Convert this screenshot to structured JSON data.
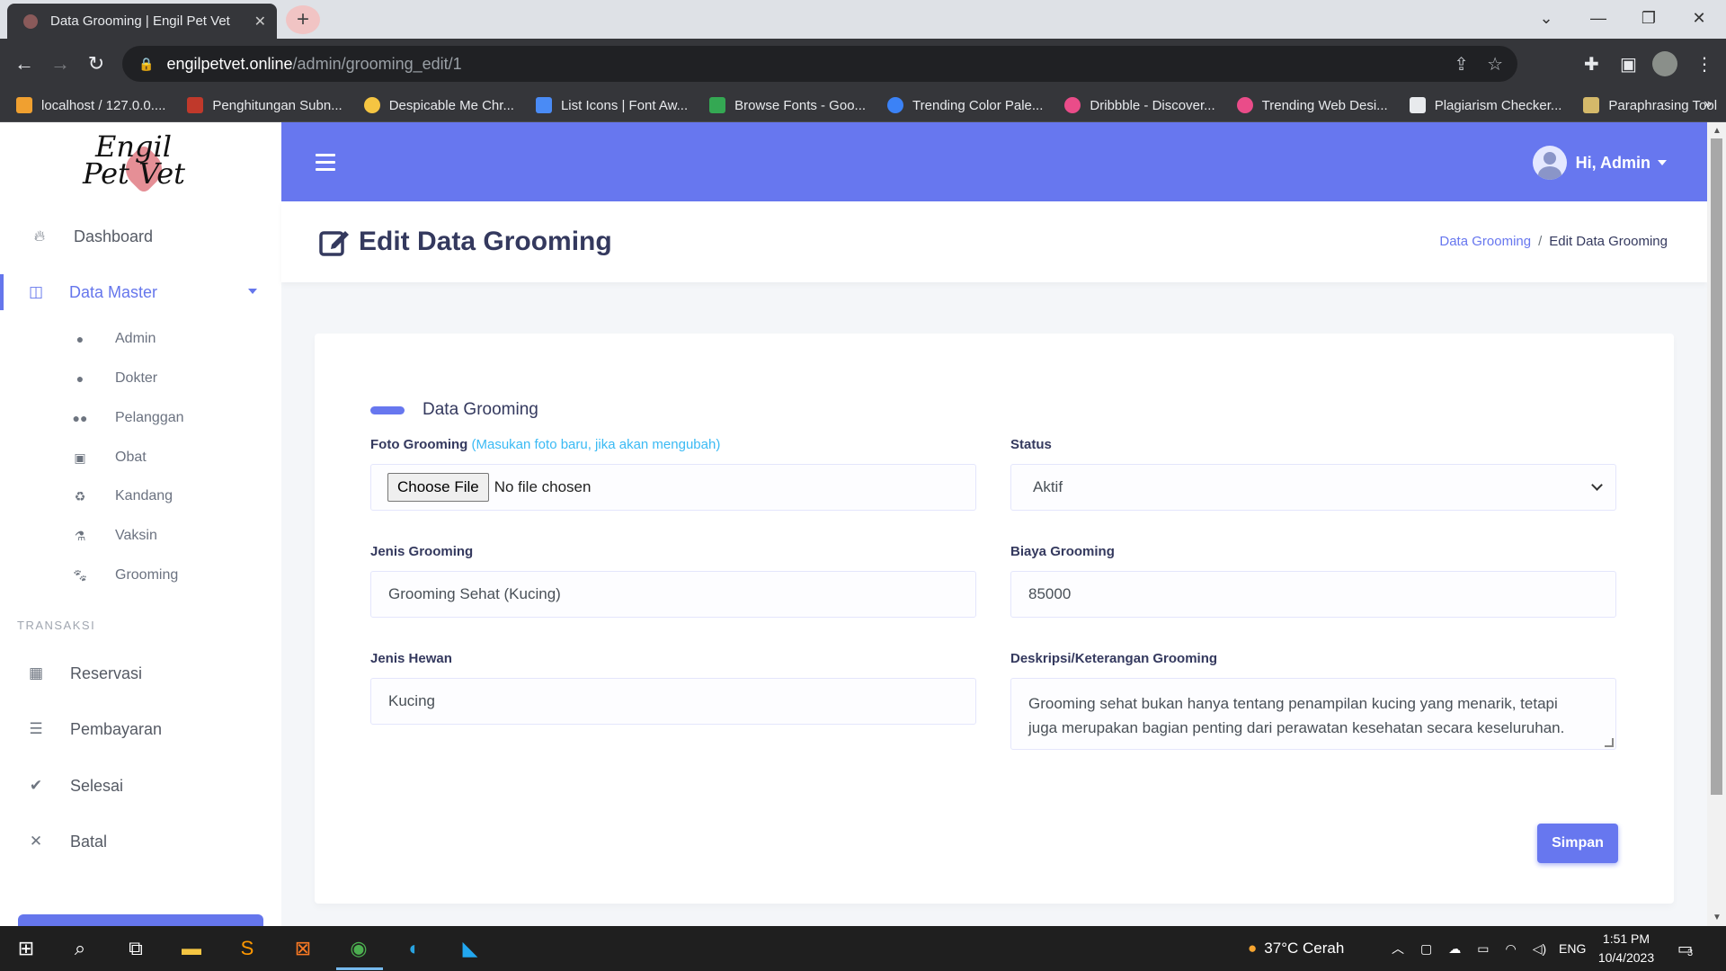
{
  "browser": {
    "tab_title": "Data Grooming | Engil Pet Vet",
    "url_host": "engilpetvet.online",
    "url_path": "/admin/grooming_edit/1",
    "bookmarks": [
      {
        "label": "localhost / 127.0.0....",
        "color": "#f0a030"
      },
      {
        "label": "Penghitungan Subn...",
        "color": "#c0392b"
      },
      {
        "label": "Despicable Me Chr...",
        "color": "#f5c542"
      },
      {
        "label": "List Icons | Font Aw...",
        "color": "#4a8bf5"
      },
      {
        "label": "Browse Fonts - Goo...",
        "color": "#34a853"
      },
      {
        "label": "Trending Color Pale...",
        "color": "#3b82f6"
      },
      {
        "label": "Dribbble - Discover...",
        "color": "#ea4c89"
      },
      {
        "label": "Trending Web Desi...",
        "color": "#ea4c89"
      },
      {
        "label": "Plagiarism Checker...",
        "color": "#e8eaed"
      },
      {
        "label": "Paraphrasing Tool",
        "color": "#d4b96a"
      }
    ]
  },
  "sidebar": {
    "logo_line1": "Engil",
    "logo_line2": "Pet Vet",
    "dashboard": "Dashboard",
    "data_master": "Data Master",
    "sub_items": [
      "Admin",
      "Dokter",
      "Pelanggan",
      "Obat",
      "Kandang",
      "Vaksin",
      "Grooming"
    ],
    "section_transaksi": "TRANSAKSI",
    "transaksi_items": [
      "Reservasi",
      "Pembayaran",
      "Selesai",
      "Batal"
    ]
  },
  "header": {
    "greeting": "Hi, Admin"
  },
  "page": {
    "title": "Edit Data Grooming",
    "breadcrumb_link": "Data Grooming",
    "breadcrumb_current": "Edit Data Grooming"
  },
  "form": {
    "section_title": "Data Grooming",
    "foto_label": "Foto Grooming",
    "foto_hint": "(Masukan foto baru, jika akan mengubah)",
    "file_button": "Choose File",
    "file_status": "No file chosen",
    "status_label": "Status",
    "status_value": "Aktif",
    "jenis_grooming_label": "Jenis Grooming",
    "jenis_grooming_value": "Grooming Sehat (Kucing)",
    "biaya_label": "Biaya Grooming",
    "biaya_value": "85000",
    "jenis_hewan_label": "Jenis Hewan",
    "jenis_hewan_value": "Kucing",
    "deskripsi_label": "Deskripsi/Keterangan Grooming",
    "deskripsi_line1": "Grooming sehat bukan hanya tentang penampilan kucing yang menarik, tetapi",
    "deskripsi_line2": "juga merupakan bagian penting dari perawatan kesehatan secara keseluruhan.",
    "save_button": "Simpan"
  },
  "taskbar": {
    "weather": "37°C  Cerah",
    "lang": "ENG",
    "time": "1:51 PM",
    "date": "10/4/2023",
    "notif_count": "3"
  },
  "colors": {
    "accent": "#6777ef",
    "heading": "#34395e",
    "hint": "#3abaf4"
  }
}
